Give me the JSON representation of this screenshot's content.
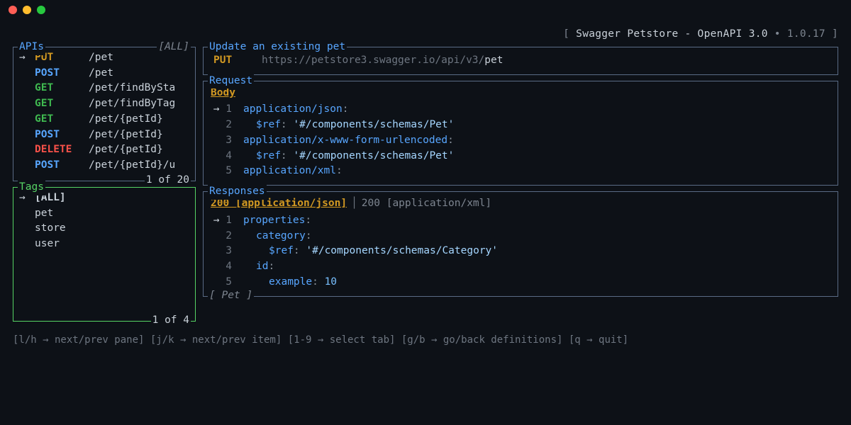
{
  "header": {
    "bracket_open": "[ ",
    "title": "Swagger Petstore - OpenAPI 3.0",
    "dot": " • ",
    "version": "1.0.17",
    "bracket_close": " ]"
  },
  "apis_panel": {
    "title": "APIs",
    "filter": "[ALL]",
    "status": "1 of 20",
    "items": [
      {
        "selected": true,
        "method": "PUT",
        "mclass": "m-put",
        "path": "/pet"
      },
      {
        "selected": false,
        "method": "POST",
        "mclass": "m-post",
        "path": "/pet"
      },
      {
        "selected": false,
        "method": "GET",
        "mclass": "m-get",
        "path": "/pet/findBySta"
      },
      {
        "selected": false,
        "method": "GET",
        "mclass": "m-get",
        "path": "/pet/findByTag"
      },
      {
        "selected": false,
        "method": "GET",
        "mclass": "m-get",
        "path": "/pet/{petId}"
      },
      {
        "selected": false,
        "method": "POST",
        "mclass": "m-post",
        "path": "/pet/{petId}"
      },
      {
        "selected": false,
        "method": "DELETE",
        "mclass": "m-delete",
        "path": "/pet/{petId}"
      },
      {
        "selected": false,
        "method": "POST",
        "mclass": "m-post",
        "path": "/pet/{petId}/u"
      }
    ]
  },
  "tags_panel": {
    "title": "Tags",
    "status": "1 of 4",
    "items": [
      {
        "selected": true,
        "label": "[ALL]"
      },
      {
        "selected": false,
        "label": "pet"
      },
      {
        "selected": false,
        "label": "store"
      },
      {
        "selected": false,
        "label": "user"
      }
    ]
  },
  "endpoint_panel": {
    "title": "Update an existing pet",
    "method": "PUT",
    "url_dim": "https://petstore3.swagger.io/api/v3/",
    "url_bright": "pet"
  },
  "request_panel": {
    "title": "Request",
    "tab_active": "Body",
    "lines": [
      {
        "n": "1",
        "sel": true,
        "indent": "ind1",
        "key": "application/json",
        "suffix": ":"
      },
      {
        "n": "2",
        "sel": false,
        "indent": "ind2",
        "key": "$ref",
        "suffix": ": ",
        "str": "'#/components/schemas/Pet'"
      },
      {
        "n": "3",
        "sel": false,
        "indent": "ind1",
        "key": "application/x-www-form-urlencoded",
        "suffix": ":"
      },
      {
        "n": "4",
        "sel": false,
        "indent": "ind2",
        "key": "$ref",
        "suffix": ": ",
        "str": "'#/components/schemas/Pet'"
      },
      {
        "n": "5",
        "sel": false,
        "indent": "ind1",
        "key": "application/xml",
        "suffix": ":"
      }
    ]
  },
  "responses_panel": {
    "title": "Responses",
    "footer_label": "[ Pet ]",
    "tab_active": "200 [application/json]",
    "tab_inactive": "200 [application/xml]",
    "lines": [
      {
        "n": "1",
        "sel": true,
        "indent": "ind1",
        "key": "properties",
        "suffix": ":"
      },
      {
        "n": "2",
        "sel": false,
        "indent": "ind2",
        "key": "category",
        "suffix": ":"
      },
      {
        "n": "3",
        "sel": false,
        "indent": "ind3",
        "key": "$ref",
        "suffix": ": ",
        "str": "'#/components/schemas/Category'"
      },
      {
        "n": "4",
        "sel": false,
        "indent": "ind2",
        "key": "id",
        "suffix": ":"
      },
      {
        "n": "5",
        "sel": false,
        "indent": "ind3",
        "key": "example",
        "suffix": ": ",
        "num": "10"
      }
    ]
  },
  "footer": {
    "hints": "[l/h → next/prev pane] [j/k → next/prev item] [1-9 → select tab] [g/b → go/back definitions] [q → quit]"
  }
}
